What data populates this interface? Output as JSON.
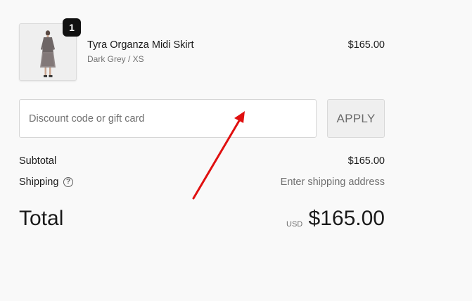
{
  "product": {
    "quantity": "1",
    "name": "Tyra Organza Midi Skirt",
    "variant": "Dark Grey / XS",
    "price": "$165.00",
    "thumbnail_icon": "model-wearing-skirt-image"
  },
  "discount": {
    "placeholder": "Discount code or gift card",
    "value": "",
    "apply_label": "APPLY"
  },
  "summary": {
    "subtotal_label": "Subtotal",
    "subtotal_value": "$165.00",
    "shipping_label": "Shipping",
    "shipping_help_icon": "question-circle-icon",
    "shipping_help_glyph": "?",
    "shipping_value": "Enter shipping address"
  },
  "total": {
    "label": "Total",
    "currency": "USD",
    "amount": "$165.00"
  },
  "annotation": {
    "type": "red-arrow",
    "color": "#e01010",
    "points_to": "discount-input"
  }
}
